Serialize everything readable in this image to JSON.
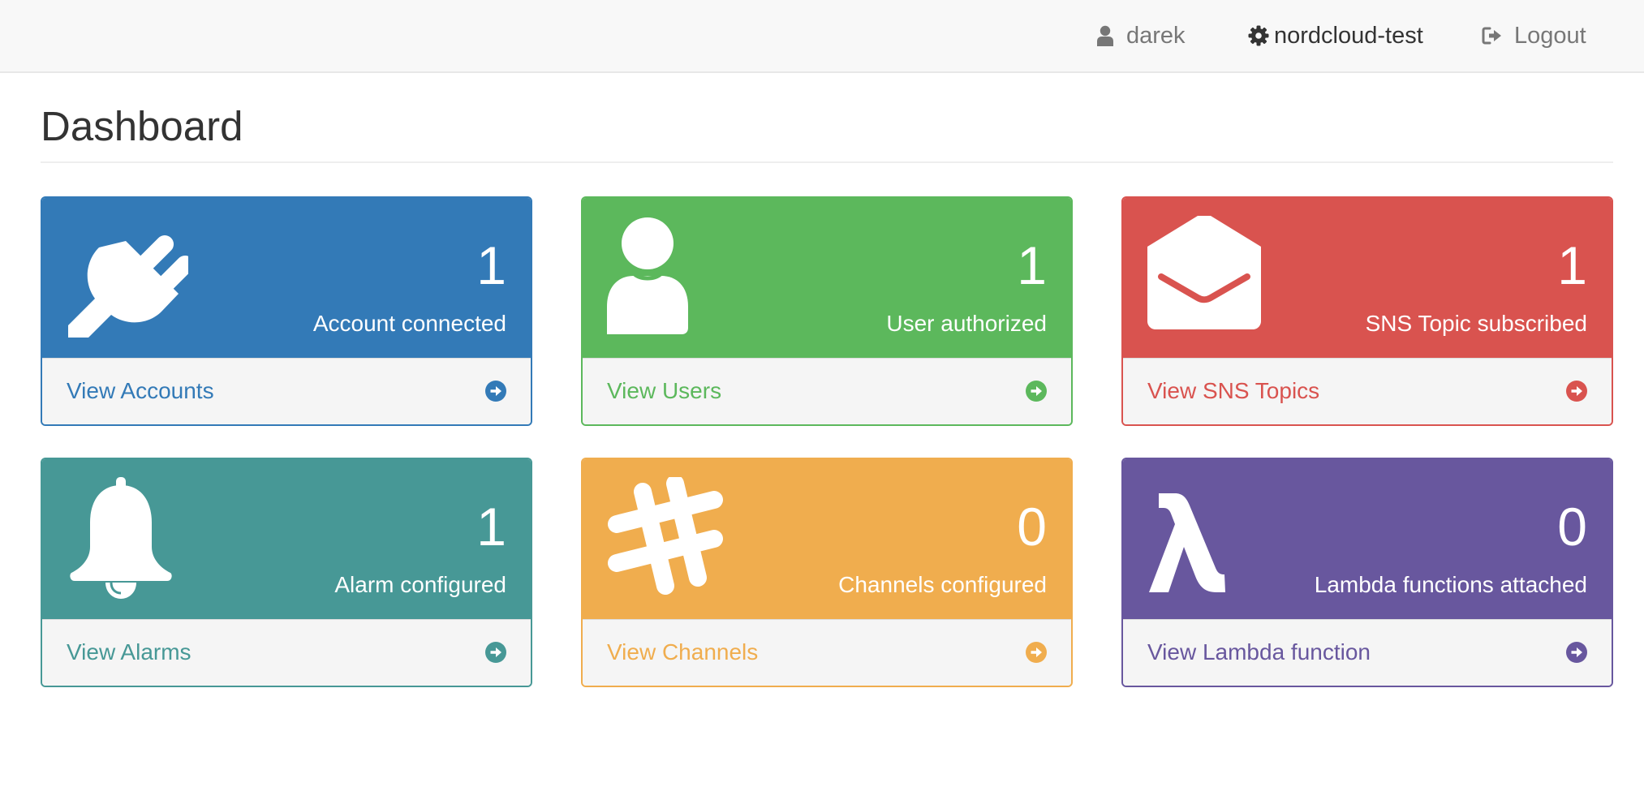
{
  "navbar": {
    "user": {
      "icon": "user-icon",
      "label": "darek"
    },
    "org": {
      "icon": "cog-icon",
      "label": "nordcloud-test"
    },
    "logout": {
      "icon": "sign-out-icon",
      "label": "Logout"
    }
  },
  "page": {
    "title": "Dashboard"
  },
  "panels": [
    {
      "icon": "plug-icon",
      "count": "1",
      "label": "Account connected",
      "link": "View Accounts",
      "color": "#337ab7"
    },
    {
      "icon": "user-icon",
      "count": "1",
      "label": "User authorized",
      "link": "View Users",
      "color": "#5cb85c"
    },
    {
      "icon": "envelope-open-icon",
      "count": "1",
      "label": "SNS Topic subscribed",
      "link": "View SNS Topics",
      "color": "#d9534f"
    },
    {
      "icon": "bell-icon",
      "count": "1",
      "label": "Alarm configured",
      "link": "View Alarms",
      "color": "#479896"
    },
    {
      "icon": "slack-hash-icon",
      "count": "0",
      "label": "Channels configured",
      "link": "View Channels",
      "color": "#f0ad4e"
    },
    {
      "icon": "lambda-icon",
      "count": "0",
      "label": "Lambda functions attached",
      "link": "View Lambda function",
      "color": "#68579e"
    }
  ]
}
